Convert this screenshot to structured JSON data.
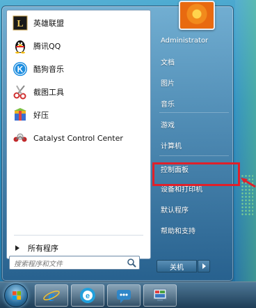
{
  "pinned_programs": [
    {
      "label": "英雄联盟",
      "icon": "league-of-legends-icon"
    },
    {
      "label": "腾讯QQ",
      "icon": "qq-penguin-icon"
    },
    {
      "label": "酷狗音乐",
      "icon": "kugou-music-icon"
    },
    {
      "label": "截图工具",
      "icon": "snipping-tool-icon"
    },
    {
      "label": "好压",
      "icon": "haozip-icon"
    },
    {
      "label": "Catalyst Control Center",
      "icon": "catalyst-control-center-icon"
    }
  ],
  "all_programs_label": "所有程序",
  "search": {
    "placeholder": "搜索程序和文件"
  },
  "right_pane": {
    "items": [
      "Administrator",
      "文档",
      "图片",
      "音乐",
      "游戏",
      "计算机",
      "控制面板",
      "设备和打印机",
      "默认程序",
      "帮助和支持"
    ],
    "highlighted_item": "控制面板"
  },
  "shutdown_label": "关机",
  "colors": {
    "highlight_border": "#e0202a",
    "annotation_arrow": "#e0202a"
  },
  "taskbar": {
    "buttons": [
      "internet-explorer-icon",
      "browser-e-icon",
      "chat-icon",
      "control-panel-icon"
    ]
  }
}
